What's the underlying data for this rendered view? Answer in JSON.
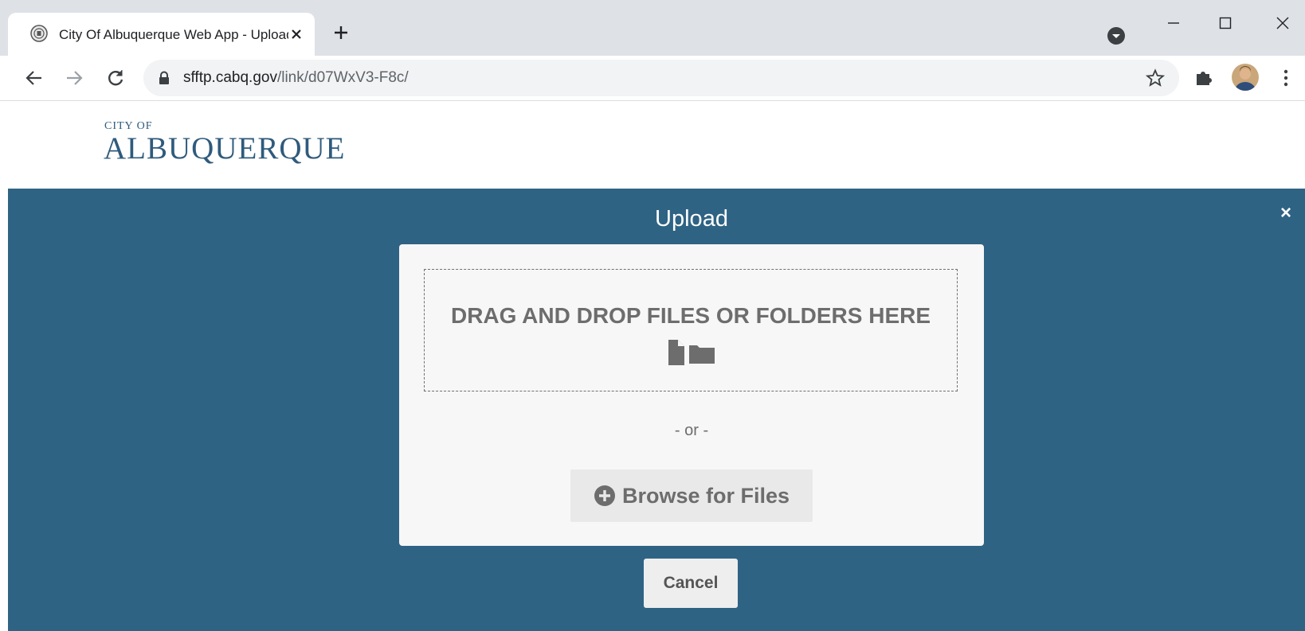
{
  "browser": {
    "tab_title": "City Of Albuquerque Web App - Upload",
    "url_host": "sfftp.cabq.gov",
    "url_path": "/link/d07WxV3-F8c/"
  },
  "site": {
    "logo_top": "CITY OF",
    "logo_main": "ALBUQUERQUE"
  },
  "modal": {
    "title": "Upload",
    "close_label": "×",
    "dropzone_text": "DRAG AND DROP FILES OR FOLDERS HERE",
    "or_text": "- or -",
    "browse_label": "Browse for Files",
    "cancel_label": "Cancel"
  },
  "colors": {
    "overlay": "#2f6384",
    "brand": "#2f5b7c",
    "card": "#f7f7f7"
  },
  "icons": [
    "city-seal-icon",
    "close-icon",
    "plus-icon",
    "profile-icon",
    "minimize-icon",
    "maximize-icon",
    "back-icon",
    "forward-icon",
    "reload-icon",
    "lock-icon",
    "star-icon",
    "puzzle-icon",
    "kebab-icon",
    "file-icon",
    "folder-icon",
    "plus-circle-icon"
  ]
}
